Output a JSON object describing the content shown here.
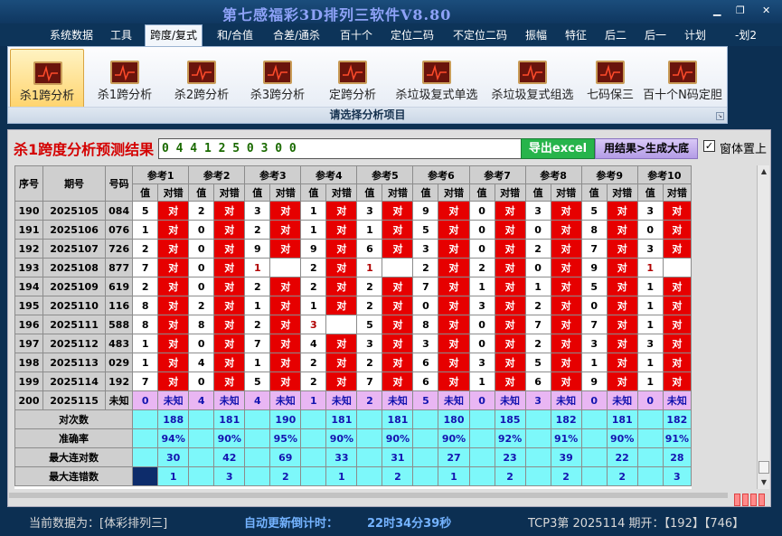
{
  "window": {
    "title": "第七感福彩3D排列三软件V8.80",
    "controls": [
      "▁",
      "❐",
      "✕"
    ]
  },
  "menu": [
    "系统数据",
    "工具",
    "跨度/复式",
    "和/合值",
    "合差/通杀",
    "百十个",
    "定位二码",
    "不定位二码",
    "振幅",
    "特征",
    "后二",
    "后一",
    "计划",
    "-划2"
  ],
  "ribbon": {
    "buttons": [
      "杀1跨分析",
      "杀1跨分析",
      "杀2跨分析",
      "杀3跨分析",
      "定跨分析",
      "杀垃圾复式单选",
      "杀垃圾复式组选",
      "七码保三",
      "百十个N码定胆"
    ],
    "group_label": "请选择分析项目"
  },
  "result": {
    "title": "杀1跨度分析预测结果",
    "value": "0 4 4 1 2 5 0 3 0 0",
    "export_label": "导出excel",
    "generate_label": "用结果>生成大底",
    "pin_label": "窗体置上",
    "pin_checked": "✓"
  },
  "table": {
    "headers": {
      "seq": "序号",
      "period": "期号",
      "code": "号码"
    },
    "refs": [
      "参考1",
      "参考2",
      "参考3",
      "参考4",
      "参考5",
      "参考6",
      "参考7",
      "参考8",
      "参考9",
      "参考10"
    ],
    "sub_value": "值",
    "sub_check": "对错",
    "hit_text": "对",
    "unknown_text": "未知",
    "rows": [
      {
        "seq": "190",
        "period": "2025105",
        "code": "084",
        "values": [
          "5",
          "2",
          "3",
          "1",
          "3",
          "9",
          "0",
          "3",
          "5",
          "3"
        ],
        "hits": [
          1,
          1,
          1,
          1,
          1,
          1,
          1,
          1,
          1,
          1
        ]
      },
      {
        "seq": "191",
        "period": "2025106",
        "code": "076",
        "values": [
          "1",
          "0",
          "2",
          "1",
          "1",
          "5",
          "0",
          "0",
          "8",
          "0"
        ],
        "hits": [
          1,
          1,
          1,
          1,
          1,
          1,
          1,
          1,
          1,
          1
        ]
      },
      {
        "seq": "192",
        "period": "2025107",
        "code": "726",
        "values": [
          "2",
          "0",
          "9",
          "9",
          "6",
          "3",
          "0",
          "2",
          "7",
          "3"
        ],
        "hits": [
          1,
          1,
          1,
          1,
          1,
          1,
          1,
          1,
          1,
          1
        ]
      },
      {
        "seq": "193",
        "period": "2025108",
        "code": "877",
        "values": [
          "7",
          "0",
          "1",
          "2",
          "1",
          "2",
          "2",
          "0",
          "9",
          "1"
        ],
        "hits": [
          1,
          1,
          0,
          1,
          0,
          1,
          1,
          1,
          1,
          0
        ]
      },
      {
        "seq": "194",
        "period": "2025109",
        "code": "619",
        "values": [
          "2",
          "0",
          "2",
          "2",
          "2",
          "7",
          "1",
          "1",
          "5",
          "1"
        ],
        "hits": [
          1,
          1,
          1,
          1,
          1,
          1,
          1,
          1,
          1,
          1
        ]
      },
      {
        "seq": "195",
        "period": "2025110",
        "code": "116",
        "values": [
          "8",
          "2",
          "1",
          "1",
          "2",
          "0",
          "3",
          "2",
          "0",
          "1"
        ],
        "hits": [
          1,
          1,
          1,
          1,
          1,
          1,
          1,
          1,
          1,
          1
        ]
      },
      {
        "seq": "196",
        "period": "2025111",
        "code": "588",
        "values": [
          "8",
          "8",
          "2",
          "3",
          "5",
          "8",
          "0",
          "7",
          "7",
          "1"
        ],
        "hits": [
          1,
          1,
          1,
          0,
          1,
          1,
          1,
          1,
          1,
          1
        ]
      },
      {
        "seq": "197",
        "period": "2025112",
        "code": "483",
        "values": [
          "1",
          "0",
          "7",
          "4",
          "3",
          "3",
          "0",
          "2",
          "3",
          "3"
        ],
        "hits": [
          1,
          1,
          1,
          1,
          1,
          1,
          1,
          1,
          1,
          1
        ]
      },
      {
        "seq": "198",
        "period": "2025113",
        "code": "029",
        "values": [
          "1",
          "4",
          "1",
          "2",
          "2",
          "6",
          "3",
          "5",
          "1",
          "1"
        ],
        "hits": [
          1,
          1,
          1,
          1,
          1,
          1,
          1,
          1,
          1,
          1
        ]
      },
      {
        "seq": "199",
        "period": "2025114",
        "code": "192",
        "values": [
          "7",
          "0",
          "5",
          "2",
          "7",
          "6",
          "1",
          "6",
          "9",
          "1"
        ],
        "hits": [
          1,
          1,
          1,
          1,
          1,
          1,
          1,
          1,
          1,
          1
        ]
      }
    ],
    "pending_row": {
      "seq": "200",
      "period": "2025115",
      "code": "未知",
      "values": [
        "0",
        "4",
        "4",
        "1",
        "2",
        "5",
        "0",
        "3",
        "0",
        "0"
      ]
    },
    "stats": [
      {
        "label": "对次数",
        "values": [
          "188",
          "181",
          "190",
          "181",
          "181",
          "180",
          "185",
          "182",
          "181",
          "182"
        ]
      },
      {
        "label": "准确率",
        "values": [
          "94%",
          "90%",
          "95%",
          "90%",
          "90%",
          "90%",
          "92%",
          "91%",
          "90%",
          "91%"
        ]
      },
      {
        "label": "最大连对数",
        "values": [
          "30",
          "42",
          "69",
          "33",
          "31",
          "27",
          "23",
          "39",
          "22",
          "28"
        ]
      },
      {
        "label": "最大连错数",
        "values": [
          "1",
          "3",
          "2",
          "1",
          "2",
          "1",
          "2",
          "2",
          "2",
          "3"
        ]
      }
    ]
  },
  "status": {
    "current": "当前数据为：[体彩排列三]",
    "countdown_label": "自动更新倒计时：",
    "countdown": "22时34分39秒",
    "draw": "TCP3第 2025114 期开：【192】【746】"
  },
  "colors": {
    "hit": "#e60000",
    "pending": "#e9b6f3",
    "stat": "#7df8fa",
    "title_accent": "#8ea2f7"
  }
}
